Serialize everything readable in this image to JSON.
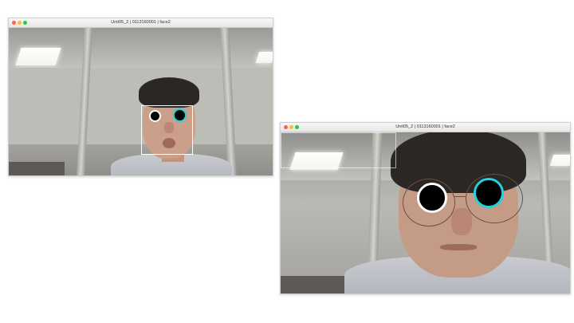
{
  "windows": [
    {
      "title": "Unit05_2 | 0113160001 | face2",
      "overlay": {
        "left_marker_ring": "#ffffff",
        "right_marker_ring": "#1fd2df",
        "face_box": true
      }
    },
    {
      "title": "Unit05_2 | 0113160001 | face2",
      "overlay": {
        "left_marker_ring": "#ffffff",
        "right_marker_ring": "#1fd2df",
        "face_box": true
      }
    }
  ],
  "colors": {
    "close": "#ff5f57",
    "minimize": "#febc2e",
    "maximize": "#28c840"
  }
}
